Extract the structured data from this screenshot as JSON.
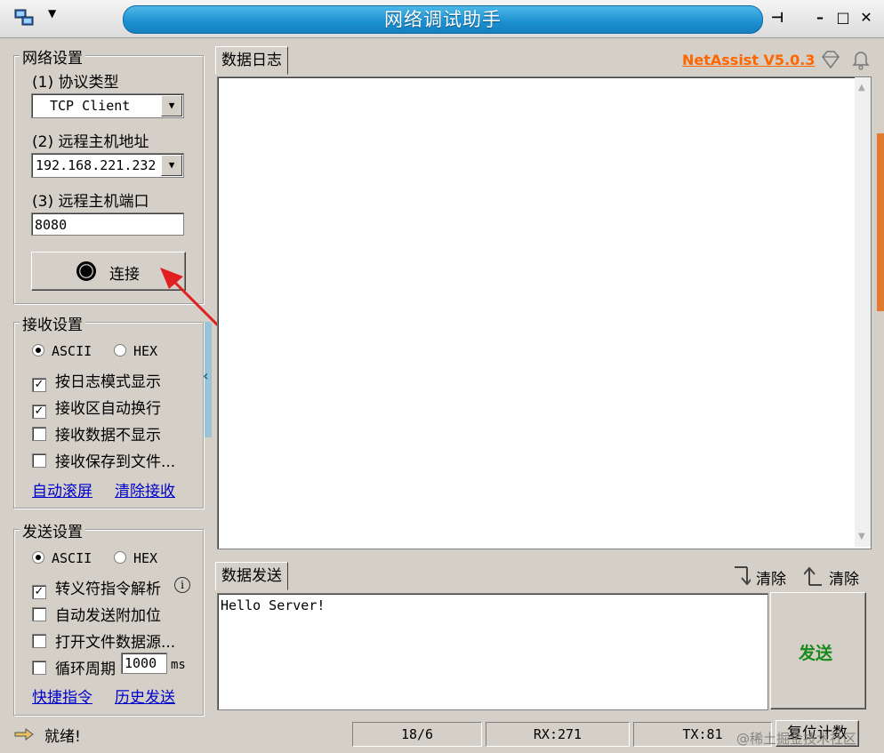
{
  "window": {
    "title": "网络调试助手",
    "minimize": "–",
    "maximize": "□",
    "close": "✕",
    "pin": "⊣"
  },
  "network_settings": {
    "title": "网络设置",
    "protocol_label": "(1) 协议类型",
    "protocol_value": "TCP Client",
    "host_label": "(2) 远程主机地址",
    "host_value": "192.168.221.232",
    "port_label": "(3) 远程主机端口",
    "port_value": "8080",
    "connect_label": "连接"
  },
  "receive_settings": {
    "title": "接收设置",
    "radio_ascii": "ASCII",
    "radio_hex": "HEX",
    "options": [
      "按日志模式显示",
      "接收区自动换行",
      "接收数据不显示",
      "接收保存到文件..."
    ],
    "checked": [
      true,
      true,
      false,
      false
    ],
    "link_autoscroll": "自动滚屏",
    "link_clear": "清除接收"
  },
  "send_settings": {
    "title": "发送设置",
    "radio_ascii": "ASCII",
    "radio_hex": "HEX",
    "options": [
      "转义符指令解析",
      "自动发送附加位",
      "打开文件数据源...",
      "循环周期"
    ],
    "checked": [
      true,
      false,
      false,
      false
    ],
    "cycle_value": "1000",
    "cycle_unit": "ms",
    "link_shortcuts": "快捷指令",
    "link_history": "历史发送"
  },
  "log": {
    "tab": "数据日志",
    "brand": "NetAssist V5.0.3"
  },
  "send": {
    "tab": "数据发送",
    "clear1": "清除",
    "clear2": "清除",
    "text": "Hello Server!",
    "button": "发送"
  },
  "status": {
    "ready": "就绪!",
    "counter": "18/6",
    "rx": "RX:271",
    "tx": "TX:81",
    "reset": "复位计数",
    "watermark": "@稀土掘金技术社区"
  },
  "colors": {
    "brand": "#ff6600",
    "send_button_text": "#1a8a1a",
    "arrow": "#e02020",
    "title_bar": "#1a8fd0"
  }
}
